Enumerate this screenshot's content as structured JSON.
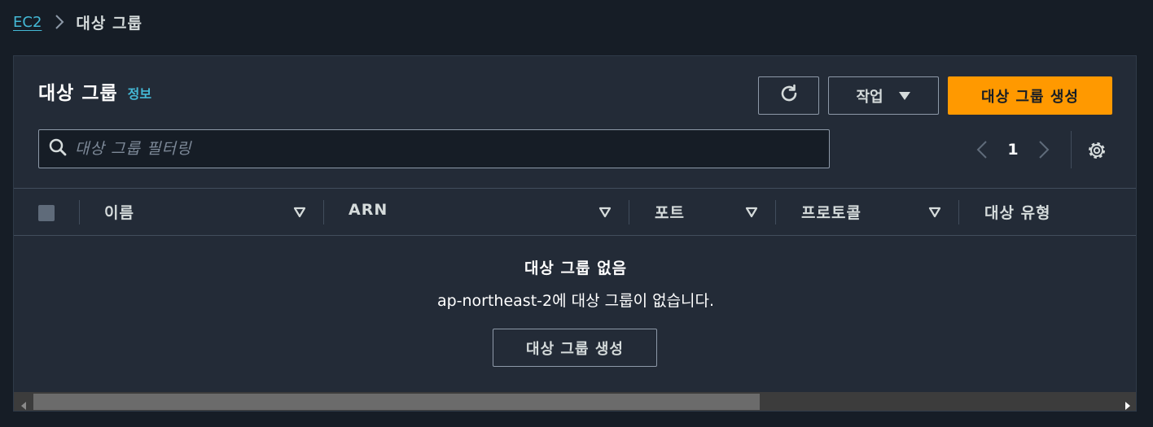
{
  "breadcrumb": {
    "root": "EC2",
    "current": "대상 그룹"
  },
  "panel": {
    "title": "대상 그룹",
    "info_link": "정보",
    "actions_label": "작업",
    "create_label": "대상 그룹 생성"
  },
  "search": {
    "placeholder": "대상 그룹 필터링"
  },
  "pagination": {
    "current_page": "1"
  },
  "table": {
    "columns": [
      "이름",
      "ARN",
      "포트",
      "프로토콜",
      "대상 유형"
    ]
  },
  "empty_state": {
    "title": "대상 그룹 없음",
    "description": "ap-northeast-2에 대상 그룹이 없습니다.",
    "button_label": "대상 그룹 생성"
  },
  "colors": {
    "accent": "#ff9900",
    "link": "#44b9d6",
    "background": "#161d26",
    "panel": "#232b37"
  }
}
